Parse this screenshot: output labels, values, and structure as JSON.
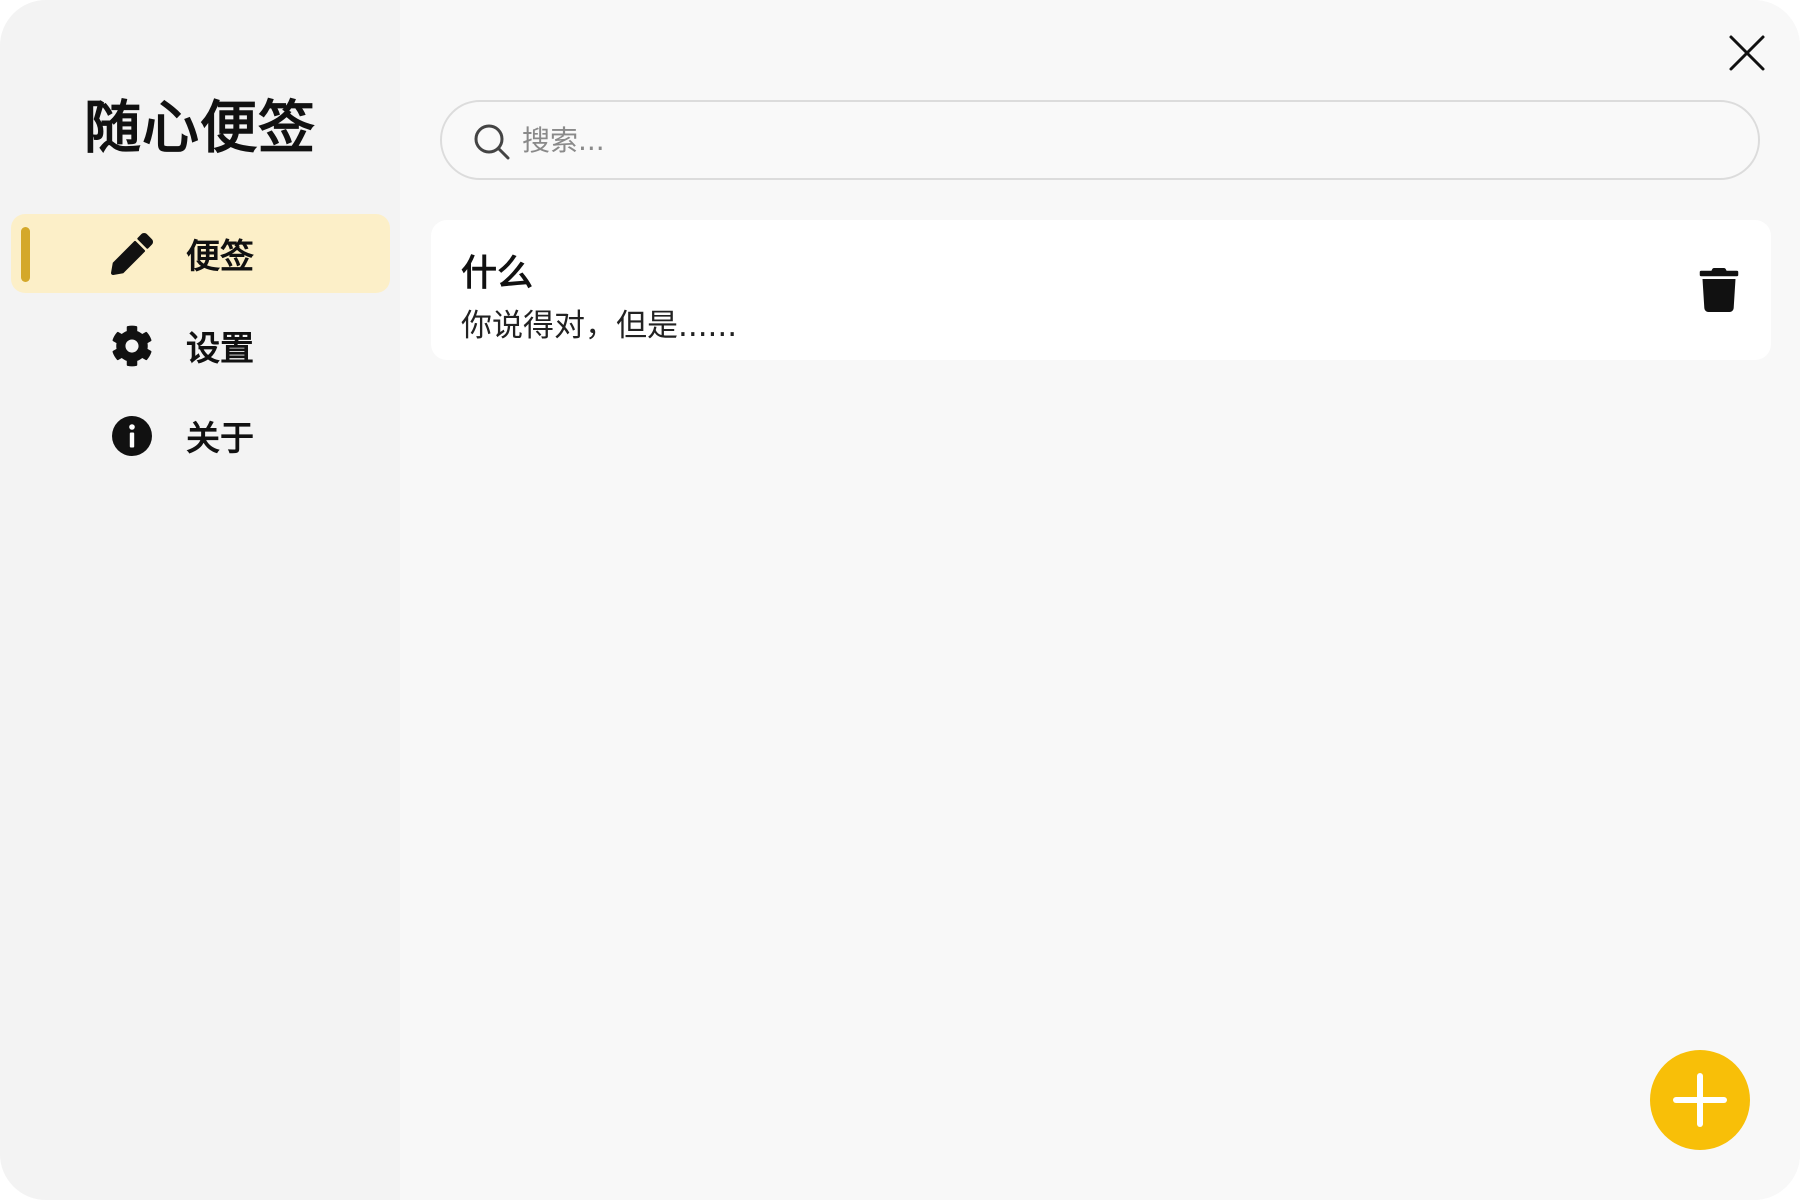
{
  "app": {
    "title": "随心便签"
  },
  "sidebar": {
    "items": [
      {
        "label": "便签",
        "icon": "pencil-icon",
        "active": true
      },
      {
        "label": "设置",
        "icon": "gear-icon",
        "active": false
      },
      {
        "label": "关于",
        "icon": "info-icon",
        "active": false
      }
    ]
  },
  "search": {
    "placeholder": "搜索...",
    "value": ""
  },
  "notes": [
    {
      "title": "什么",
      "preview": "你说得对，但是......"
    }
  ],
  "icons": {
    "close": "close-icon",
    "search": "search-icon",
    "delete": "trash-icon",
    "add": "plus-icon"
  },
  "colors": {
    "accent": "#f8bf08",
    "active_bg": "#fcefc8",
    "indicator": "#d4a82a"
  }
}
